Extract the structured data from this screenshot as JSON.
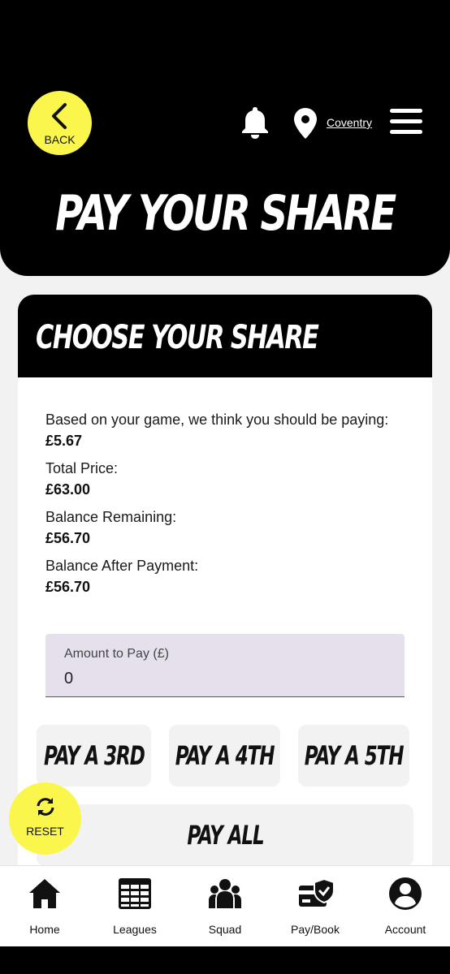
{
  "header": {
    "back_label": "BACK",
    "location": "Coventry",
    "title": "PAY YOUR SHARE"
  },
  "card": {
    "title": "CHOOSE YOUR SHARE",
    "suggested_label": "Based on your game, we think you should be paying:",
    "suggested_value": "£5.67",
    "total_label": "Total Price:",
    "total_value": "£63.00",
    "remaining_label": "Balance Remaining:",
    "remaining_value": "£56.70",
    "after_label": "Balance After Payment:",
    "after_value": "£56.70",
    "amount_label": "Amount to Pay (£)",
    "amount_value": "0"
  },
  "buttons": {
    "third": "PAY A 3RD",
    "fourth": "PAY A 4TH",
    "fifth": "PAY A 5TH",
    "all": "PAY ALL",
    "reset": "RESET"
  },
  "nav": [
    {
      "label": "Home",
      "icon": "home-icon"
    },
    {
      "label": "Leagues",
      "icon": "table-icon"
    },
    {
      "label": "Squad",
      "icon": "group-icon"
    },
    {
      "label": "Pay/Book",
      "icon": "card-check-icon"
    },
    {
      "label": "Account",
      "icon": "account-icon"
    }
  ],
  "colors": {
    "accent_yellow": "#fbf64b",
    "header_black": "#000000",
    "field_bg": "#e6e0ec"
  }
}
